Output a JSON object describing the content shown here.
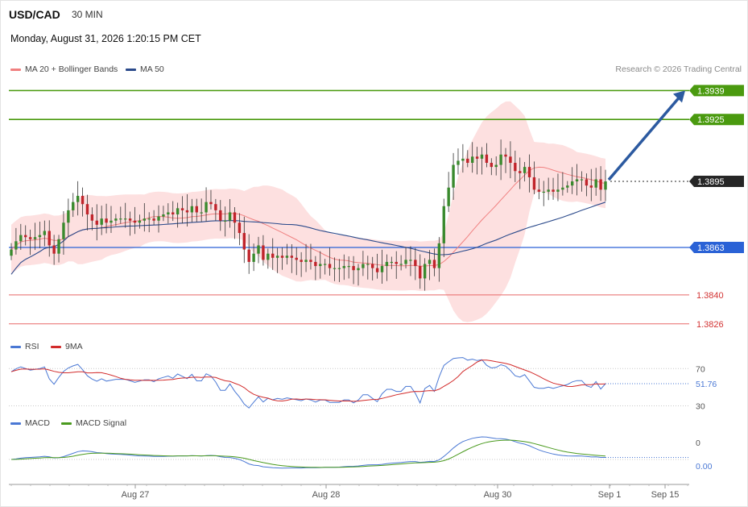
{
  "header": {
    "pair": "USD/CAD",
    "timeframe": "30 MIN",
    "datetime": "Monday, August 31, 2026 1:20:15 PM CET",
    "credit": "Research © 2026 Trading Central"
  },
  "legends": {
    "price": [
      {
        "label": "MA 20 + Bollinger Bands",
        "color": "#f08080"
      },
      {
        "label": "MA 50",
        "color": "#2b4a8b"
      }
    ],
    "rsi": [
      {
        "label": "RSI",
        "color": "#4a78d4"
      },
      {
        "label": "9MA",
        "color": "#d22b2b"
      }
    ],
    "macd": [
      {
        "label": "MACD",
        "color": "#4a78d4"
      },
      {
        "label": "MACD Signal",
        "color": "#4a9a1e"
      }
    ]
  },
  "colors": {
    "bull": "#3a8a2e",
    "bear": "#c0242b",
    "bollinger_fill": "#fde0e0",
    "ma20": "#f08080",
    "ma50": "#2b4a8b",
    "resistance": "#4a9a0f",
    "support": "#e86868",
    "pivot": "#2a62d6",
    "current": "#262626",
    "arrow": "#2c5aa0"
  },
  "chart_data": [
    {
      "type": "candlestick",
      "panel": "price",
      "x_ticks": [
        "Aug 27",
        "Aug 28",
        "Aug 30",
        "Sep 1",
        "Sep 15"
      ],
      "ylim": [
        1.3822,
        1.3945
      ],
      "levels": [
        {
          "value": 1.3939,
          "label": "1.3939",
          "kind": "resistance"
        },
        {
          "value": 1.3925,
          "label": "1.3925",
          "kind": "resistance"
        },
        {
          "value": 1.3895,
          "label": "1.3895",
          "kind": "current"
        },
        {
          "value": 1.3863,
          "label": "1.3863",
          "kind": "pivot"
        },
        {
          "value": 1.384,
          "label": "1.3840",
          "kind": "support"
        },
        {
          "value": 1.3826,
          "label": "1.3826",
          "kind": "support"
        }
      ],
      "closes": [
        1.3862,
        1.3866,
        1.3869,
        1.3868,
        1.3867,
        1.3868,
        1.3869,
        1.3871,
        1.3864,
        1.386,
        1.3867,
        1.3875,
        1.3881,
        1.3885,
        1.3888,
        1.3884,
        1.3879,
        1.3876,
        1.3874,
        1.3877,
        1.3875,
        1.3876,
        1.3877,
        1.3877,
        1.3877,
        1.3876,
        1.3875,
        1.3876,
        1.3877,
        1.3877,
        1.3876,
        1.3878,
        1.3879,
        1.388,
        1.3879,
        1.3882,
        1.3881,
        1.388,
        1.3883,
        1.388,
        1.388,
        1.3885,
        1.3884,
        1.3881,
        1.3876,
        1.3876,
        1.388,
        1.3875,
        1.387,
        1.3862,
        1.3856,
        1.386,
        1.3864,
        1.3857,
        1.386,
        1.3858,
        1.3859,
        1.3858,
        1.3859,
        1.3858,
        1.3857,
        1.3856,
        1.3857,
        1.3856,
        1.3854,
        1.3855,
        1.3855,
        1.3853,
        1.3853,
        1.3853,
        1.3854,
        1.3854,
        1.3852,
        1.3853,
        1.3855,
        1.3855,
        1.3853,
        1.3851,
        1.3854,
        1.3856,
        1.3856,
        1.3855,
        1.3855,
        1.3857,
        1.3857,
        1.3854,
        1.3848,
        1.3855,
        1.3857,
        1.3853,
        1.3865,
        1.3883,
        1.3892,
        1.3903,
        1.3905,
        1.3906,
        1.3904,
        1.3907,
        1.3906,
        1.3908,
        1.3904,
        1.3902,
        1.3903,
        1.3908,
        1.3907,
        1.3904,
        1.39,
        1.3899,
        1.3902,
        1.3897,
        1.3891,
        1.389,
        1.389,
        1.3891,
        1.389,
        1.3891,
        1.3892,
        1.3893,
        1.3895,
        1.3896,
        1.3896,
        1.3893,
        1.3892,
        1.3896,
        1.3891,
        1.3895
      ]
    },
    {
      "type": "line",
      "panel": "rsi",
      "series": [
        {
          "name": "RSI"
        },
        {
          "name": "9MA"
        }
      ],
      "reference_levels": [
        70,
        30
      ],
      "current_value": "51.76",
      "ylim": [
        20,
        85
      ]
    },
    {
      "type": "line",
      "panel": "macd",
      "series": [
        {
          "name": "MACD"
        },
        {
          "name": "MACD Signal"
        }
      ],
      "reference_levels": [
        0
      ],
      "current_value": "0.00"
    }
  ]
}
